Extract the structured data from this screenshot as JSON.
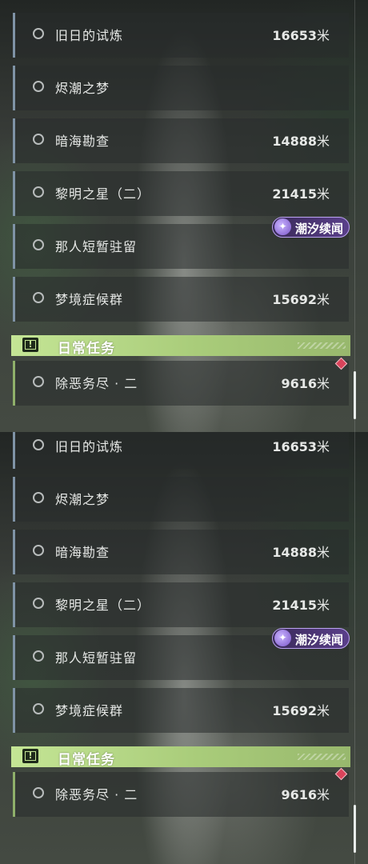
{
  "quests": [
    {
      "name": "旧日的试炼",
      "distance": "16653",
      "unit": "米"
    },
    {
      "name": "烬潮之梦",
      "distance": "",
      "unit": ""
    },
    {
      "name": "暗海勘查",
      "distance": "14888",
      "unit": "米"
    },
    {
      "name": "黎明之星（二）",
      "distance": "21415",
      "unit": "米"
    },
    {
      "name": "那人短暂驻留",
      "distance": "",
      "unit": ""
    },
    {
      "name": "梦境症候群",
      "distance": "15692",
      "unit": "米"
    }
  ],
  "event_badge": {
    "label": "潮汐续闻",
    "icon": "event-swirl-icon"
  },
  "daily_section": {
    "title": "日常任务",
    "icon": "exclamation-box-icon"
  },
  "daily_quest": {
    "name": "除恶务尽 · 二",
    "distance": "9616",
    "unit": "米"
  },
  "colors": {
    "quest_accent": "#7f93a6",
    "daily_accent": "#c4e595",
    "badge_purple": "#5a3f8a",
    "alert_red": "#d9435a"
  }
}
